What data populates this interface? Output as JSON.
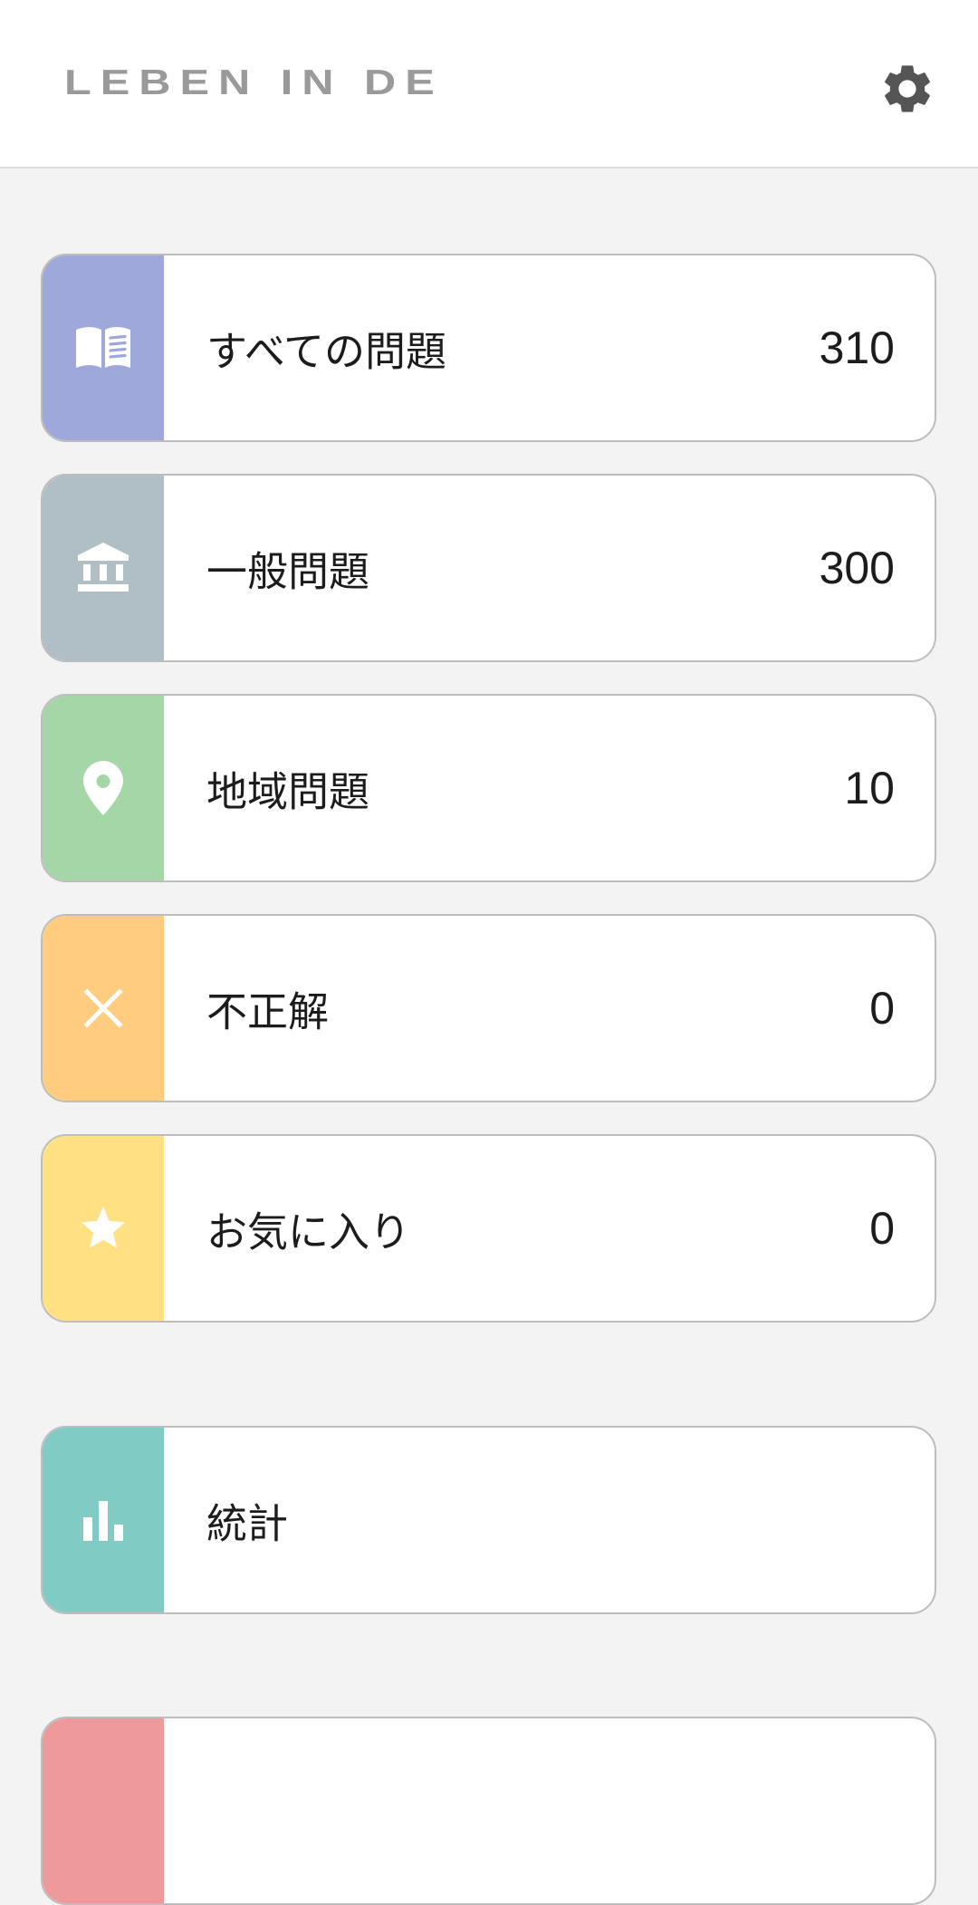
{
  "header": {
    "title": "LEBEN IN DE",
    "settings_icon": "gear-icon"
  },
  "menu": [
    {
      "label": "すべての問題",
      "count": "310",
      "icon": "book-icon",
      "color": "#9fa8da"
    },
    {
      "label": "一般問題",
      "count": "300",
      "icon": "bank-icon",
      "color": "#b0bec5"
    },
    {
      "label": "地域問題",
      "count": "10",
      "icon": "location-pin-icon",
      "color": "#a5d6a7"
    },
    {
      "label": "不正解",
      "count": "0",
      "icon": "close-icon",
      "color": "#ffcc80"
    },
    {
      "label": "お気に入り",
      "count": "0",
      "icon": "star-icon",
      "color": "#ffe082"
    }
  ],
  "stats": {
    "label": "統計",
    "icon": "bar-chart-icon",
    "color": "#80cbc4"
  },
  "partial_card": {
    "color": "#ef9a9a"
  }
}
